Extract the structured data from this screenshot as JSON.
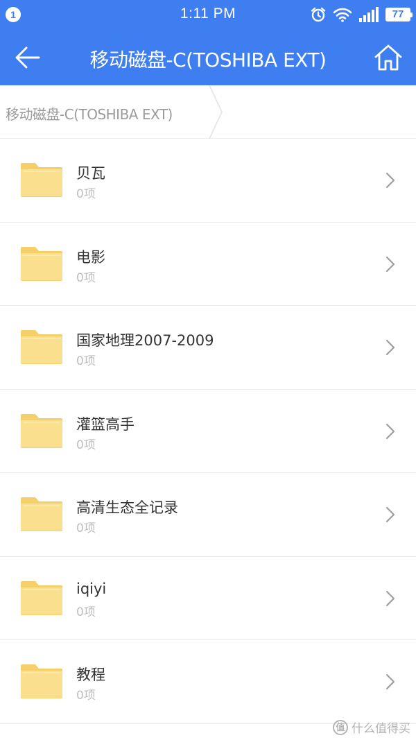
{
  "status_bar": {
    "notification_count": "1",
    "time": "1:11 PM",
    "icons": [
      "alarm-icon",
      "wifi-icon",
      "signal-icon"
    ],
    "battery_level": "77"
  },
  "app_bar": {
    "title": "移动磁盘-C(TOSHIBA EXT)",
    "back_icon": "arrow-left-icon",
    "home_icon": "home-icon"
  },
  "breadcrumb": {
    "items": [
      "移动磁盘-C(TOSHIBA EXT)"
    ]
  },
  "folders": [
    {
      "name": "贝瓦",
      "count": "0项"
    },
    {
      "name": "电影",
      "count": "0项"
    },
    {
      "name": "国家地理2007-2009",
      "count": "0项"
    },
    {
      "name": "灌篮高手",
      "count": "0项"
    },
    {
      "name": "高清生态全记录",
      "count": "0项"
    },
    {
      "name": "iqiyi",
      "count": "0项"
    },
    {
      "name": "教程",
      "count": "0项"
    }
  ],
  "watermark": {
    "logo": "值",
    "text": "什么值得买"
  },
  "colors": {
    "primary": "#3e7ef0",
    "folder": "#f9dd8a",
    "text_primary": "#333333",
    "text_secondary": "#bdbdbd"
  }
}
